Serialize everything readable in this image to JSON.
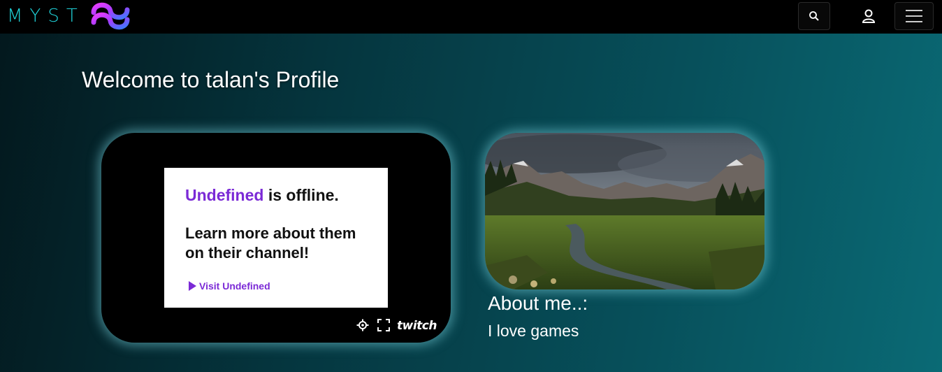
{
  "header": {
    "logo_text": "MYST",
    "icons": [
      "search-icon",
      "user-icon",
      "menu-icon"
    ]
  },
  "welcome": {
    "title": "Welcome to talan's Profile"
  },
  "player": {
    "channel_name": "Undefined",
    "offline_suffix": " is offline.",
    "learn_more": "Learn more about them on their channel!",
    "visit_label": "Visit Undefined",
    "brand": "twitch",
    "controls": [
      "settings-icon",
      "fullscreen-icon"
    ]
  },
  "about": {
    "title": "About me..:",
    "text": "I love games"
  },
  "colors": {
    "accent_cyan": "#1fd1d8",
    "twitch_purple": "#7b2ad6",
    "glow": "#78d2dc"
  }
}
